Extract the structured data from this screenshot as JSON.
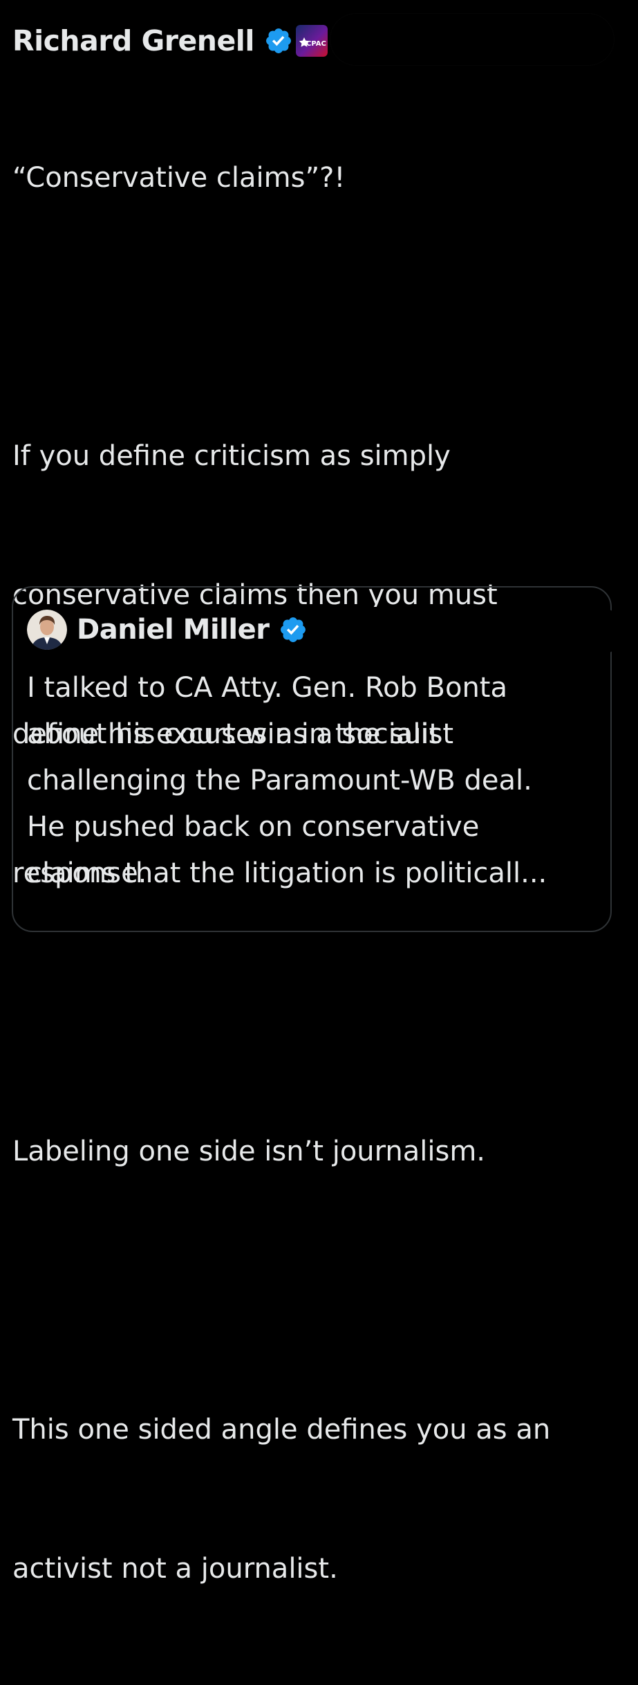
{
  "post": {
    "author_name": "Richard Grenell",
    "verified_icon": "verified-badge-icon",
    "affiliation_badge_icon": "cpac-badge-icon",
    "affiliation_badge_text": "CPAC",
    "text_lines": [
      "“Conservative claims”?!",
      "",
      "If you define criticism as simply",
      "conservative claims then you must",
      "define his excuses as a socialist",
      "response.",
      "",
      "Labeling one side isn’t journalism.",
      "",
      "This one sided angle defines you as an",
      "activist not a journalist."
    ]
  },
  "quoted_post": {
    "author_name": "Daniel Miller",
    "avatar_icon": "avatar-image",
    "verified_icon": "verified-badge-icon",
    "text_lines": [
      "I talked to CA Atty. Gen. Rob Bonta",
      "about his court win in the suit",
      "challenging the Paramount-WB deal.",
      "He pushed back on conservative",
      "claims that the litigation is politicall..."
    ]
  },
  "colors": {
    "background": "#000000",
    "text": "#e7e9ea",
    "verified_blue": "#1d9bf0",
    "card_border": "#2f3336",
    "badge_red": "#c8102e",
    "badge_blue": "#1a2a6c"
  }
}
